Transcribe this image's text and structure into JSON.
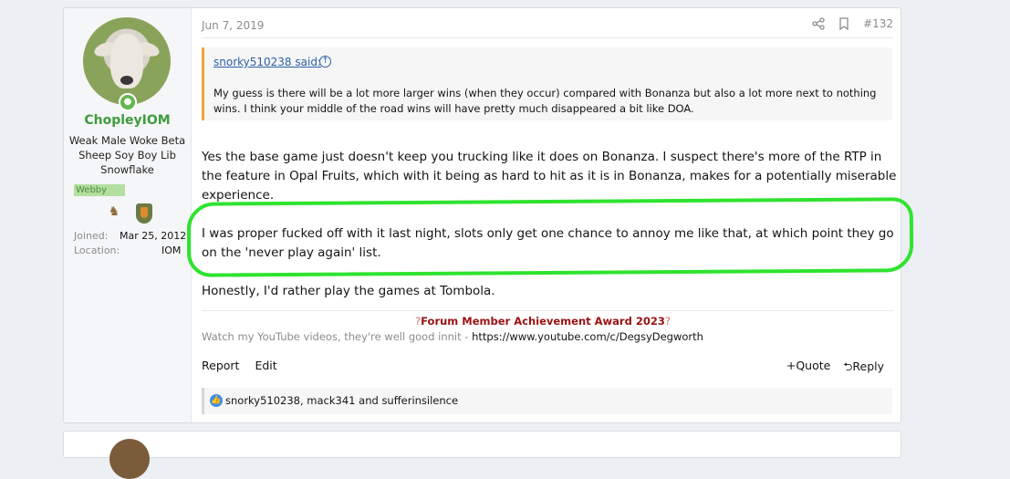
{
  "post": {
    "user": {
      "name": "ChopleyIOM",
      "title": "Weak Male Woke Beta Sheep Soy Boy Lib Snowflake",
      "banner": "Webby",
      "online_icon": "person-icon",
      "joined_label": "Joined:",
      "joined_value": "Mar 25, 2012",
      "location_label": "Location:",
      "location_value": "IOM"
    },
    "date": "Jun 7, 2019",
    "number": "#132",
    "quote": {
      "author": "snorky510238 said:",
      "text": "My guess is there will be a lot more larger wins (when they occur) compared with Bonanza but also a lot more next to nothing wins. I think your middle of the road wins will have pretty much disappeared a bit like DOA."
    },
    "paragraphs": [
      "Yes the base game just doesn't keep you trucking like it does on Bonanza. I suspect there's more of the RTP in the feature in Opal Fruits, which with it being as hard to hit as it is in Bonanza, makes for a potentially miserable experience.",
      "I was proper fucked off with it last night, slots only get one chance to annoy me like that, at which point they go on the 'never play again' list.",
      "Honestly, I'd rather play the games at Tombola."
    ],
    "highlight_color": "#2fe32f",
    "signature": {
      "award_q1": "?",
      "award_title": "Forum Member Achievement Award 2023",
      "award_q2": "?",
      "line2": "Watch my YouTube videos, they're well good innit - ",
      "url": "https://www.youtube.com/c/DegsyDegworth"
    },
    "actions": {
      "report": "Report",
      "edit": "Edit",
      "quote": "Quote",
      "reply": "Reply"
    },
    "reactions": "snorky510238, mack341 and sufferinsilence"
  }
}
